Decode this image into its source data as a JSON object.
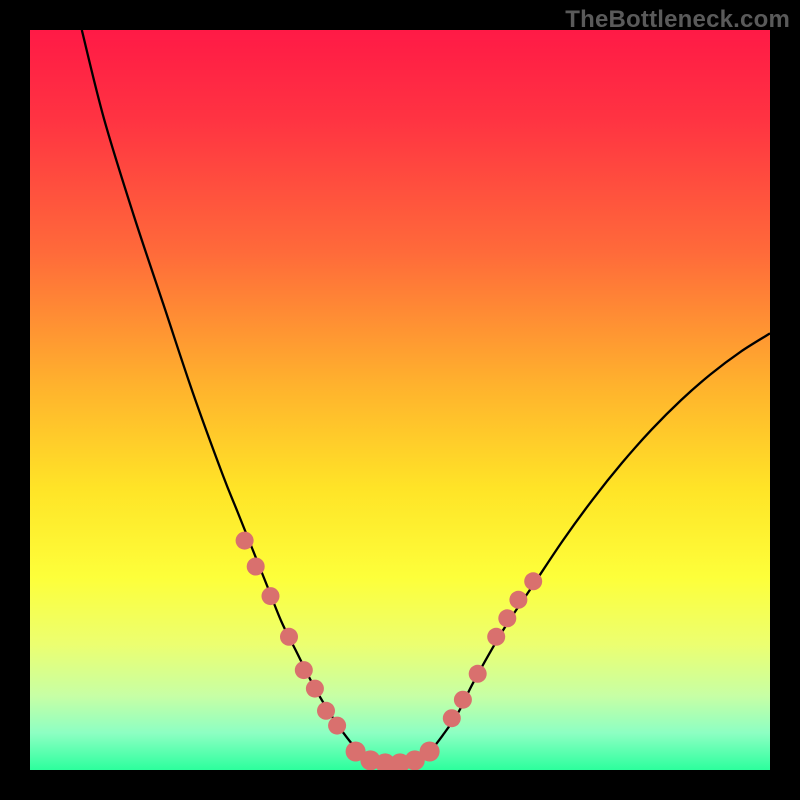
{
  "watermark_text": "TheBottleneck.com",
  "chart_data": {
    "type": "line",
    "title": "",
    "xlabel": "",
    "ylabel": "",
    "xlim": [
      0,
      100
    ],
    "ylim": [
      0,
      100
    ],
    "grid": false,
    "legend": false,
    "background_gradient_stops": [
      {
        "offset": 0.0,
        "color": "#ff1a46"
      },
      {
        "offset": 0.12,
        "color": "#ff3342"
      },
      {
        "offset": 0.3,
        "color": "#ff6a3a"
      },
      {
        "offset": 0.48,
        "color": "#ffb22d"
      },
      {
        "offset": 0.62,
        "color": "#ffe427"
      },
      {
        "offset": 0.74,
        "color": "#fdff3a"
      },
      {
        "offset": 0.83,
        "color": "#ecff70"
      },
      {
        "offset": 0.9,
        "color": "#c7ffa5"
      },
      {
        "offset": 0.95,
        "color": "#8dffc3"
      },
      {
        "offset": 1.0,
        "color": "#2cff9d"
      }
    ],
    "series": [
      {
        "name": "bottleneck-curve",
        "x": [
          7,
          10,
          14,
          18,
          22,
          26,
          28,
          30,
          32,
          34,
          36,
          38,
          40,
          42,
          44,
          46,
          48,
          50,
          52,
          54,
          56,
          58,
          60,
          64,
          68,
          72,
          76,
          80,
          84,
          88,
          92,
          96,
          100
        ],
        "values": [
          100,
          88,
          75,
          63,
          51,
          40,
          35,
          30,
          25,
          20,
          16,
          12,
          8.5,
          5.5,
          3.0,
          1.5,
          0.8,
          0.8,
          1.2,
          2.5,
          5.0,
          8.0,
          12,
          19,
          25,
          31,
          36.5,
          41.5,
          46,
          50,
          53.5,
          56.5,
          59
        ]
      }
    ],
    "markers": [
      {
        "name": "left-cluster",
        "color": "#d9706e",
        "radius": 9,
        "points": [
          {
            "x": 29.0,
            "y": 31.0
          },
          {
            "x": 30.5,
            "y": 27.5
          },
          {
            "x": 32.5,
            "y": 23.5
          },
          {
            "x": 35.0,
            "y": 18.0
          },
          {
            "x": 37.0,
            "y": 13.5
          },
          {
            "x": 38.5,
            "y": 11.0
          },
          {
            "x": 40.0,
            "y": 8.0
          },
          {
            "x": 41.5,
            "y": 6.0
          }
        ]
      },
      {
        "name": "bottom-cluster",
        "color": "#d9706e",
        "radius": 10,
        "points": [
          {
            "x": 44.0,
            "y": 2.5
          },
          {
            "x": 46.0,
            "y": 1.3
          },
          {
            "x": 48.0,
            "y": 0.9
          },
          {
            "x": 50.0,
            "y": 0.9
          },
          {
            "x": 52.0,
            "y": 1.3
          },
          {
            "x": 54.0,
            "y": 2.5
          }
        ]
      },
      {
        "name": "right-cluster",
        "color": "#d9706e",
        "radius": 9,
        "points": [
          {
            "x": 57.0,
            "y": 7.0
          },
          {
            "x": 58.5,
            "y": 9.5
          },
          {
            "x": 60.5,
            "y": 13.0
          },
          {
            "x": 63.0,
            "y": 18.0
          },
          {
            "x": 64.5,
            "y": 20.5
          },
          {
            "x": 66.0,
            "y": 23.0
          },
          {
            "x": 68.0,
            "y": 25.5
          }
        ]
      }
    ]
  }
}
